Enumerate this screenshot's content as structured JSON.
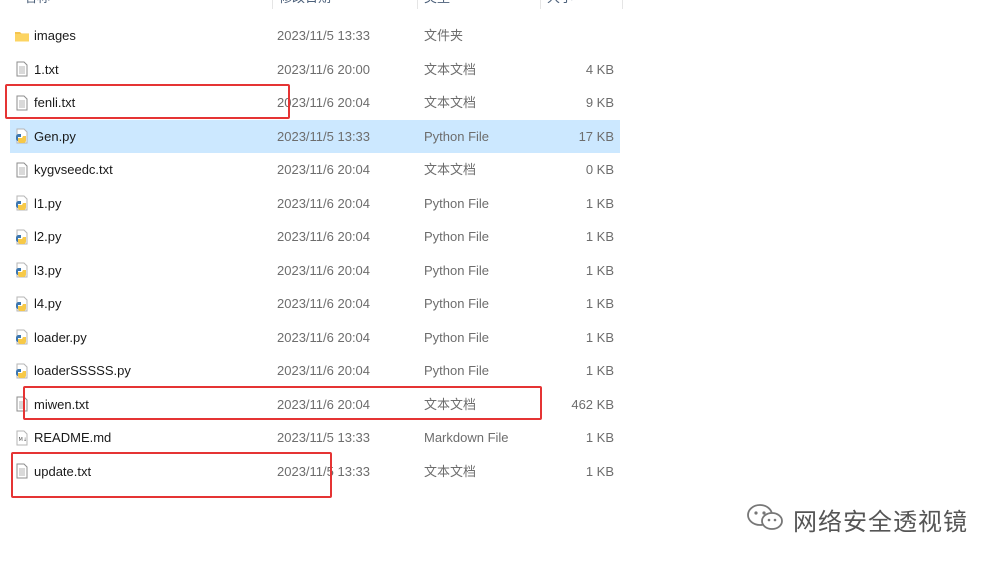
{
  "columns": {
    "name": "名称",
    "date": "修改日期",
    "type": "类型",
    "size": "大小"
  },
  "files": [
    {
      "name": "images",
      "date": "2023/11/5 13:33",
      "type": "文件夹",
      "size": "",
      "icon": "folder-icon"
    },
    {
      "name": "1.txt",
      "date": "2023/11/6 20:00",
      "type": "文本文档",
      "size": "4 KB",
      "icon": "text-file-icon"
    },
    {
      "name": "fenli.txt",
      "date": "2023/11/6 20:04",
      "type": "文本文档",
      "size": "9 KB",
      "icon": "text-file-icon"
    },
    {
      "name": "Gen.py",
      "date": "2023/11/5 13:33",
      "type": "Python File",
      "size": "17 KB",
      "icon": "python-file-icon",
      "selected": true
    },
    {
      "name": "kygvseedc.txt",
      "date": "2023/11/6 20:04",
      "type": "文本文档",
      "size": "0 KB",
      "icon": "text-file-icon"
    },
    {
      "name": "l1.py",
      "date": "2023/11/6 20:04",
      "type": "Python File",
      "size": "1 KB",
      "icon": "python-file-icon"
    },
    {
      "name": "l2.py",
      "date": "2023/11/6 20:04",
      "type": "Python File",
      "size": "1 KB",
      "icon": "python-file-icon"
    },
    {
      "name": "l3.py",
      "date": "2023/11/6 20:04",
      "type": "Python File",
      "size": "1 KB",
      "icon": "python-file-icon"
    },
    {
      "name": "l4.py",
      "date": "2023/11/6 20:04",
      "type": "Python File",
      "size": "1 KB",
      "icon": "python-file-icon"
    },
    {
      "name": "loader.py",
      "date": "2023/11/6 20:04",
      "type": "Python File",
      "size": "1 KB",
      "icon": "python-file-icon"
    },
    {
      "name": "loaderSSSSS.py",
      "date": "2023/11/6 20:04",
      "type": "Python File",
      "size": "1 KB",
      "icon": "python-file-icon"
    },
    {
      "name": "miwen.txt",
      "date": "2023/11/6 20:04",
      "type": "文本文档",
      "size": "462 KB",
      "icon": "text-file-icon"
    },
    {
      "name": "README.md",
      "date": "2023/11/5 13:33",
      "type": "Markdown File",
      "size": "1 KB",
      "icon": "markdown-file-icon"
    },
    {
      "name": "update.txt",
      "date": "2023/11/5 13:33",
      "type": "文本文档",
      "size": "1 KB",
      "icon": "text-file-icon"
    }
  ],
  "colors": {
    "selection": "#cce8ff",
    "highlight_box": "#e53434",
    "folder": "#f5c44e"
  },
  "watermark": {
    "text": "网络安全透视镜",
    "icon": "wechat-icon"
  }
}
